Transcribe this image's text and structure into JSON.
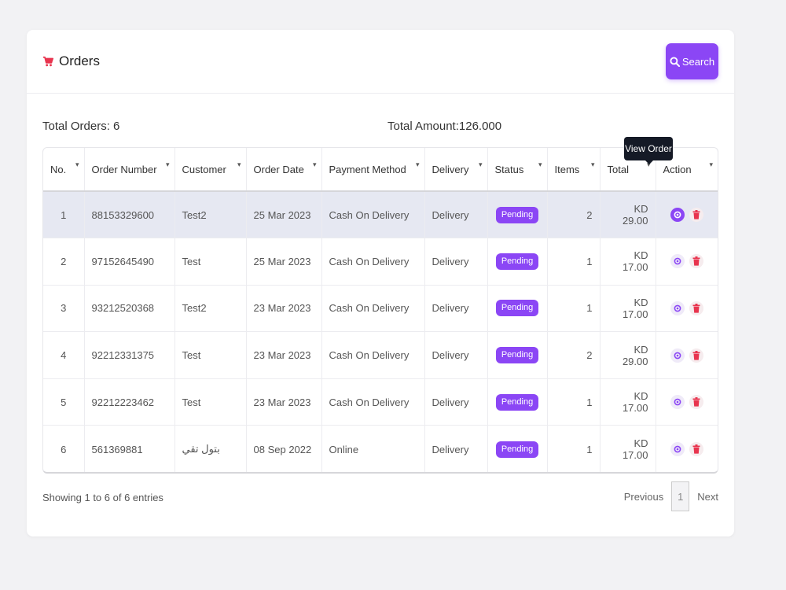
{
  "header": {
    "title": "Orders",
    "search_label": "Search"
  },
  "summary": {
    "total_orders": "Total Orders: 6",
    "total_amount": "Total Amount:126.000"
  },
  "table": {
    "columns": [
      "No.",
      "Order Number",
      "Customer",
      "Order Date",
      "Payment Method",
      "Delivery",
      "Status",
      "Items",
      "Total",
      "Action"
    ],
    "rows": [
      {
        "no": "1",
        "order_number": "88153329600",
        "customer": "Test2",
        "date": "25 Mar 2023",
        "payment": "Cash On Delivery",
        "delivery": "Delivery",
        "status": "Pending",
        "items": "2",
        "total": "KD 29.00"
      },
      {
        "no": "2",
        "order_number": "97152645490",
        "customer": "Test",
        "date": "25 Mar 2023",
        "payment": "Cash On Delivery",
        "delivery": "Delivery",
        "status": "Pending",
        "items": "1",
        "total": "KD 17.00"
      },
      {
        "no": "3",
        "order_number": "93212520368",
        "customer": "Test2",
        "date": "23 Mar 2023",
        "payment": "Cash On Delivery",
        "delivery": "Delivery",
        "status": "Pending",
        "items": "1",
        "total": "KD 17.00"
      },
      {
        "no": "4",
        "order_number": "92212331375",
        "customer": "Test",
        "date": "23 Mar 2023",
        "payment": "Cash On Delivery",
        "delivery": "Delivery",
        "status": "Pending",
        "items": "2",
        "total": "KD 29.00"
      },
      {
        "no": "5",
        "order_number": "92212223462",
        "customer": "Test",
        "date": "23 Mar 2023",
        "payment": "Cash On Delivery",
        "delivery": "Delivery",
        "status": "Pending",
        "items": "1",
        "total": "KD 17.00"
      },
      {
        "no": "6",
        "order_number": "561369881",
        "customer": "بتول تقي",
        "date": "08 Sep 2022",
        "payment": "Online",
        "delivery": "Delivery",
        "status": "Pending",
        "items": "1",
        "total": "KD 17.00"
      }
    ]
  },
  "tooltip": "View Order",
  "footer": {
    "info": "Showing 1 to 6 of 6 entries",
    "previous": "Previous",
    "page": "1",
    "next": "Next"
  },
  "colors": {
    "accent": "#8b46f5",
    "danger": "#e8344e",
    "highlight_row": "#e6e8f2",
    "tooltip_bg": "#151a26"
  },
  "icons": {
    "title": "cart-icon",
    "search": "search-icon",
    "view": "eye-icon",
    "delete": "trash-icon",
    "sort": "sort-icon"
  }
}
